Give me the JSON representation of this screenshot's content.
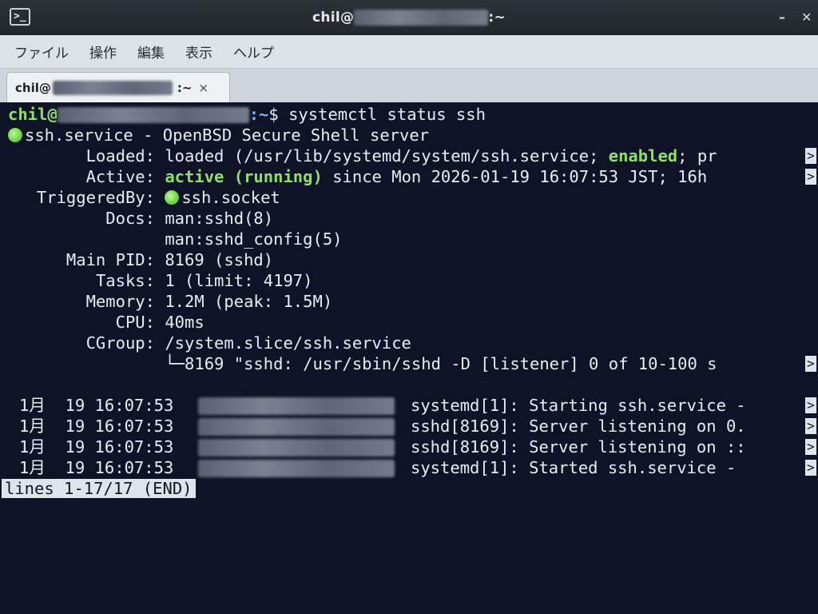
{
  "window": {
    "title_prefix": "chil@",
    "title_suffix": ":~",
    "icon": "terminal-icon",
    "controls": {
      "icon": "close-icon"
    }
  },
  "menu": [
    "ファイル",
    "操作",
    "編集",
    "表示",
    "ヘルプ"
  ],
  "tab": {
    "prefix": "chil@",
    "suffix": ":~",
    "close": "×"
  },
  "terminal": {
    "prompt_user": "chil@",
    "prompt_path": ":~",
    "prompt_sign": "$",
    "command": " systemctl status ssh",
    "service_line": "ssh.service - OpenBSD Secure Shell server",
    "loaded_key": "Loaded:",
    "loaded_pre": " loaded (/usr/lib/systemd/system/ssh.service; ",
    "loaded_enabled": "enabled",
    "loaded_post": "; pr",
    "active_key": "Active:",
    "active_state": " active (running)",
    "active_post": " since Mon 2026-01-19 16:07:53 JST; 16h",
    "triggered_key": "TriggeredBy:",
    "triggered_val": "ssh.socket",
    "docs_key": "Docs:",
    "docs_val1": " man:sshd(8)",
    "docs_val2": " man:sshd_config(5)",
    "pid_key": "Main PID:",
    "pid_val": " 8169 (sshd)",
    "tasks_key": "Tasks:",
    "tasks_val": " 1 (limit: 4197)",
    "memory_key": "Memory:",
    "memory_val": " 1.2M (peak: 1.5M)",
    "cpu_key": "CPU:",
    "cpu_val": " 40ms",
    "cgroup_key": "CGroup:",
    "cgroup_val": " /system.slice/ssh.service",
    "cgroup_child": " └─8169 \"sshd: /usr/sbin/sshd -D [listener] 0 of 10-100 s",
    "overflow_mark": ">",
    "journal": [
      {
        "date": "1月  19 16:07:53",
        "msg": "systemd[1]: Starting ssh.service -"
      },
      {
        "date": "1月  19 16:07:53",
        "msg": "sshd[8169]: Server listening on 0."
      },
      {
        "date": "1月  19 16:07:53",
        "msg": "sshd[8169]: Server listening on ::"
      },
      {
        "date": "1月  19 16:07:53",
        "msg": "systemd[1]: Started ssh.service - "
      }
    ],
    "pager_status": "lines 1-17/17 (END)"
  },
  "colors": {
    "terminal_bg": "#0e1426",
    "prompt_green": "#8ee06a",
    "prompt_blue": "#7fb0ff",
    "text": "#e9ecf2"
  }
}
